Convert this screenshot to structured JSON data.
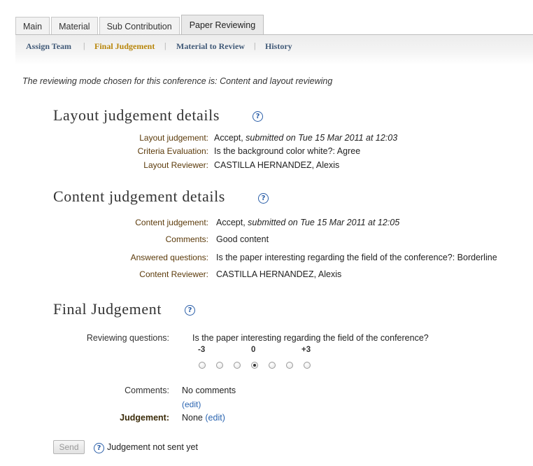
{
  "tabs": [
    {
      "label": "Main"
    },
    {
      "label": "Material"
    },
    {
      "label": "Sub Contribution"
    },
    {
      "label": "Paper Reviewing"
    }
  ],
  "subnav": {
    "items": [
      "Assign Team",
      "Final Judgement",
      "Material to Review",
      "History"
    ],
    "active": "Final Judgement",
    "separator": "|"
  },
  "mode_note": "The reviewing mode chosen for this conference is: Content and layout reviewing",
  "layout": {
    "title": "Layout judgement details",
    "help_icon": "?",
    "rows": [
      {
        "label": "Layout judgement:",
        "value": "Accept,",
        "detail": "submitted on Tue 15 Mar 2011 at 12:03"
      },
      {
        "label": "Criteria Evaluation:",
        "value": "Is the background color white?: Agree"
      },
      {
        "label": "Layout Reviewer:",
        "value": "CASTILLA HERNANDEZ, Alexis"
      }
    ]
  },
  "content": {
    "title": "Content judgement details",
    "help_icon": "?",
    "rows": [
      {
        "label": "Content judgement:",
        "value": "Accept,",
        "detail": "submitted on Tue 15 Mar 2011 at 12:05"
      },
      {
        "label": "Comments:",
        "value": "Good content"
      },
      {
        "label": "Answered questions:",
        "value": "Is the paper interesting regarding the field of the conference?: Borderline"
      },
      {
        "label": "Content Reviewer:",
        "value": "CASTILLA HERNANDEZ, Alexis"
      }
    ]
  },
  "final": {
    "title": "Final Judgement",
    "help_icon": "?",
    "questions_label": "Reviewing questions:",
    "question": "Is the paper interesting regarding the field of the conference?",
    "scale_min": "-3",
    "scale_mid": "0",
    "scale_max": "+3",
    "radio_count": 7,
    "selected_index": 3,
    "comments_label": "Comments:",
    "comments_value": "No comments",
    "edit_link": "(edit)",
    "judgement_label": "Judgement:",
    "judgement_value": "None",
    "judgement_edit": "(edit)"
  },
  "footer": {
    "send_label": "Send",
    "help_icon": "?",
    "status": "Judgement not sent yet"
  },
  "colors": {
    "link": "#2a64b0",
    "active_subnav": "#b8860b",
    "subnav": "#415a78",
    "help_icon": "#2a5ea8"
  }
}
